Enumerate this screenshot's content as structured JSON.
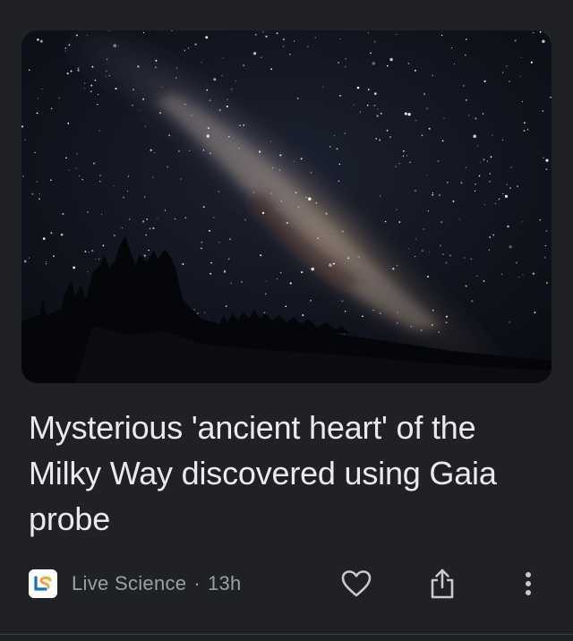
{
  "article": {
    "headline": "Mysterious 'ancient heart' of the Milky Way discovered using Gaia probe",
    "source": "Live Science",
    "separator": "·",
    "time": "13h"
  },
  "image": {
    "icon": "milky-way-night-sky-photo"
  },
  "actions": {
    "like_icon": "heart-outline-icon",
    "share_icon": "share-icon",
    "more_icon": "more-vertical-icon"
  },
  "colors": {
    "background": "#202124",
    "headline": "#e8eaed",
    "meta": "#9aa0a6",
    "logo_orange": "#f2a33a",
    "logo_blue": "#1f6fb5"
  }
}
